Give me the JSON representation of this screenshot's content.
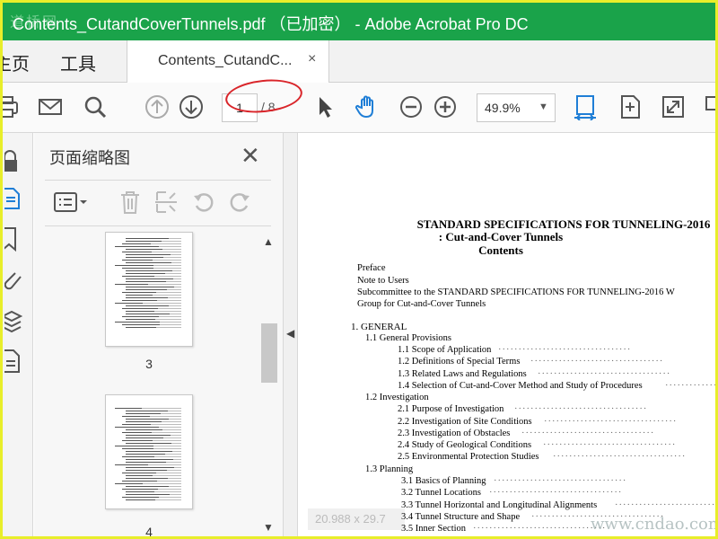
{
  "window": {
    "title": "Contents_CutandCoverTunnels.pdf （已加密） - Adobe Acrobat Pro DC",
    "watermark": "道桥网"
  },
  "tabs": {
    "home_partial": "主页",
    "tools": "工具",
    "document": "Contents_CutandC...",
    "close_symbol": "×"
  },
  "toolbar": {
    "page_current": "1",
    "page_total": "/ 8",
    "zoom": "49.9%",
    "icons": [
      "print-icon",
      "mail-icon",
      "search-icon",
      "page-up-icon",
      "page-down-icon",
      "select-icon",
      "hand-icon",
      "zoom-out-icon",
      "zoom-in-icon",
      "fit-width-icon",
      "fit-page-icon",
      "fullscreen-icon"
    ]
  },
  "thumbnail_panel": {
    "title": "页面缩略图",
    "close_symbol": "✕",
    "pages": [
      {
        "label": "3"
      },
      {
        "label": "4"
      }
    ]
  },
  "document": {
    "title_line1": "STANDARD SPECIFICATIONS FOR TUNNELING-2016",
    "title_line2": ": Cut-and-Cover Tunnels",
    "title_line3": "Contents",
    "front": [
      "Preface",
      "Note to Users",
      "Subcommittee to the STANDARD SPECIFICATIONS FOR TUNNELING-2016 W",
      "Group for Cut-and-Cover Tunnels"
    ],
    "chapter": "1.    GENERAL",
    "s11": "1.1 General Provisions",
    "s11_items": [
      "1.1 Scope of Application",
      "1.2 Definitions of Special Terms",
      "1.3 Related Laws and Regulations",
      "1.4 Selection of Cut-and-Cover Method and Study of Procedures"
    ],
    "s12": "1.2 Investigation",
    "s12_items": [
      "2.1 Purpose of Investigation",
      "2.2 Investigation of Site Conditions",
      "2.3 Investigation of Obstacles",
      "2.4 Study of Geological Conditions",
      "2.5 Environmental Protection Studies"
    ],
    "s13": "1.3 Planning",
    "s13_items": [
      "3.1 Basics of Planning",
      "3.2 Tunnel Locations",
      "3.3 Tunnel Horizontal and Longitudinal Alignments",
      "3.4 Tunnel Structure and Shape",
      "3.5 Inner Section"
    ],
    "leader": "·································"
  },
  "status": {
    "page_size": "20.988 x 29.7",
    "site_watermark": "www.cndao.com"
  }
}
